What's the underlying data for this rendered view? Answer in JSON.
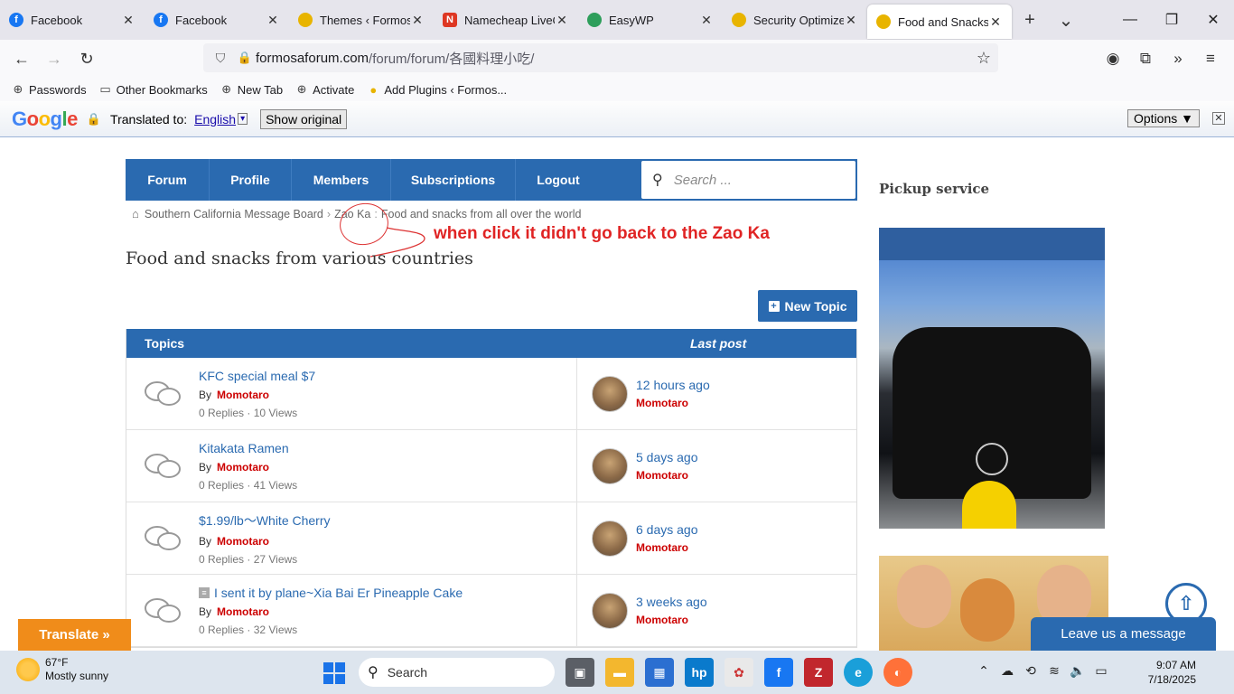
{
  "browser": {
    "tabs": [
      {
        "label": "Facebook",
        "icon": "facebook-icon",
        "color": "#1877f2"
      },
      {
        "label": "Facebook",
        "icon": "facebook-icon",
        "color": "#1877f2"
      },
      {
        "label": "Themes ‹ Formosa F",
        "icon": "pineapple-icon",
        "color": "#e8b400"
      },
      {
        "label": "Namecheap LiveCh",
        "icon": "namecheap-icon",
        "color": "#de3723"
      },
      {
        "label": "EasyWP",
        "icon": "octopus-icon",
        "color": "#2e9e5b"
      },
      {
        "label": "Security Optimizer",
        "icon": "pineapple-icon",
        "color": "#e8b400"
      },
      {
        "label": "Food and Snacks fr",
        "icon": "pineapple-icon",
        "color": "#e8b400"
      }
    ],
    "url_domain": "formosaforum.com",
    "url_path": "/forum/forum/各國料理小吃/",
    "bookmarks": [
      "Passwords",
      "Other Bookmarks",
      "New Tab",
      "Activate",
      "Add Plugins ‹ Formos..."
    ]
  },
  "translate_bar": {
    "logo_letters": [
      "G",
      "o",
      "o",
      "g",
      "l",
      "e"
    ],
    "translated_to": "Translated to:",
    "language": "English",
    "dropdown": "▾",
    "show_original": "Show original",
    "options": "Options ▼",
    "close": "✕"
  },
  "forum": {
    "nav": [
      "Forum",
      "Profile",
      "Members",
      "Subscriptions",
      "Logout"
    ],
    "search_placeholder": "Search ...",
    "breadcrumb": [
      "Southern California Message Board",
      "Zao Ka",
      "Food and snacks from all over the world"
    ],
    "annotation": "when click it didn't go back to the Zao Ka",
    "page_title": "Food and snacks from various countries",
    "new_topic": "New Topic",
    "col_topics": "Topics",
    "col_lastpost": "Last post",
    "by_label": "By",
    "topics": [
      {
        "title": "KFC special meal $7",
        "author": "Momotaro",
        "stats": "0 Replies · 10 Views",
        "last_time": "12 hours ago",
        "last_author": "Momotaro",
        "sticky": false
      },
      {
        "title": "Kitakata Ramen",
        "author": "Momotaro",
        "stats": "0 Replies · 41 Views",
        "last_time": "5 days ago",
        "last_author": "Momotaro",
        "sticky": false
      },
      {
        "title": "$1.99/lb～White Cherry",
        "author": "Momotaro",
        "stats": "0 Replies · 27 Views",
        "last_time": "6 days ago",
        "last_author": "Momotaro",
        "sticky": false
      },
      {
        "title": "I sent it by plane~Xia Bai Er Pineapple Cake",
        "author": "Momotaro",
        "stats": "0 Replies · 32 Views",
        "last_time": "3 weeks ago",
        "last_author": "Momotaro",
        "sticky": true
      }
    ]
  },
  "sidebar": {
    "title": "Pickup service"
  },
  "widgets": {
    "translate_btn": "Translate »",
    "leave_message": "Leave us a message",
    "scroll_top": "⇧"
  },
  "taskbar": {
    "temp": "67°F",
    "condition": "Mostly sunny",
    "search": "Search",
    "time": "9:07 AM",
    "date": "7/18/2025"
  },
  "colors": {
    "brand": "#2a6ab0",
    "author": "#cc0000",
    "annotation": "#e02424",
    "translate": "#f08c1a"
  }
}
